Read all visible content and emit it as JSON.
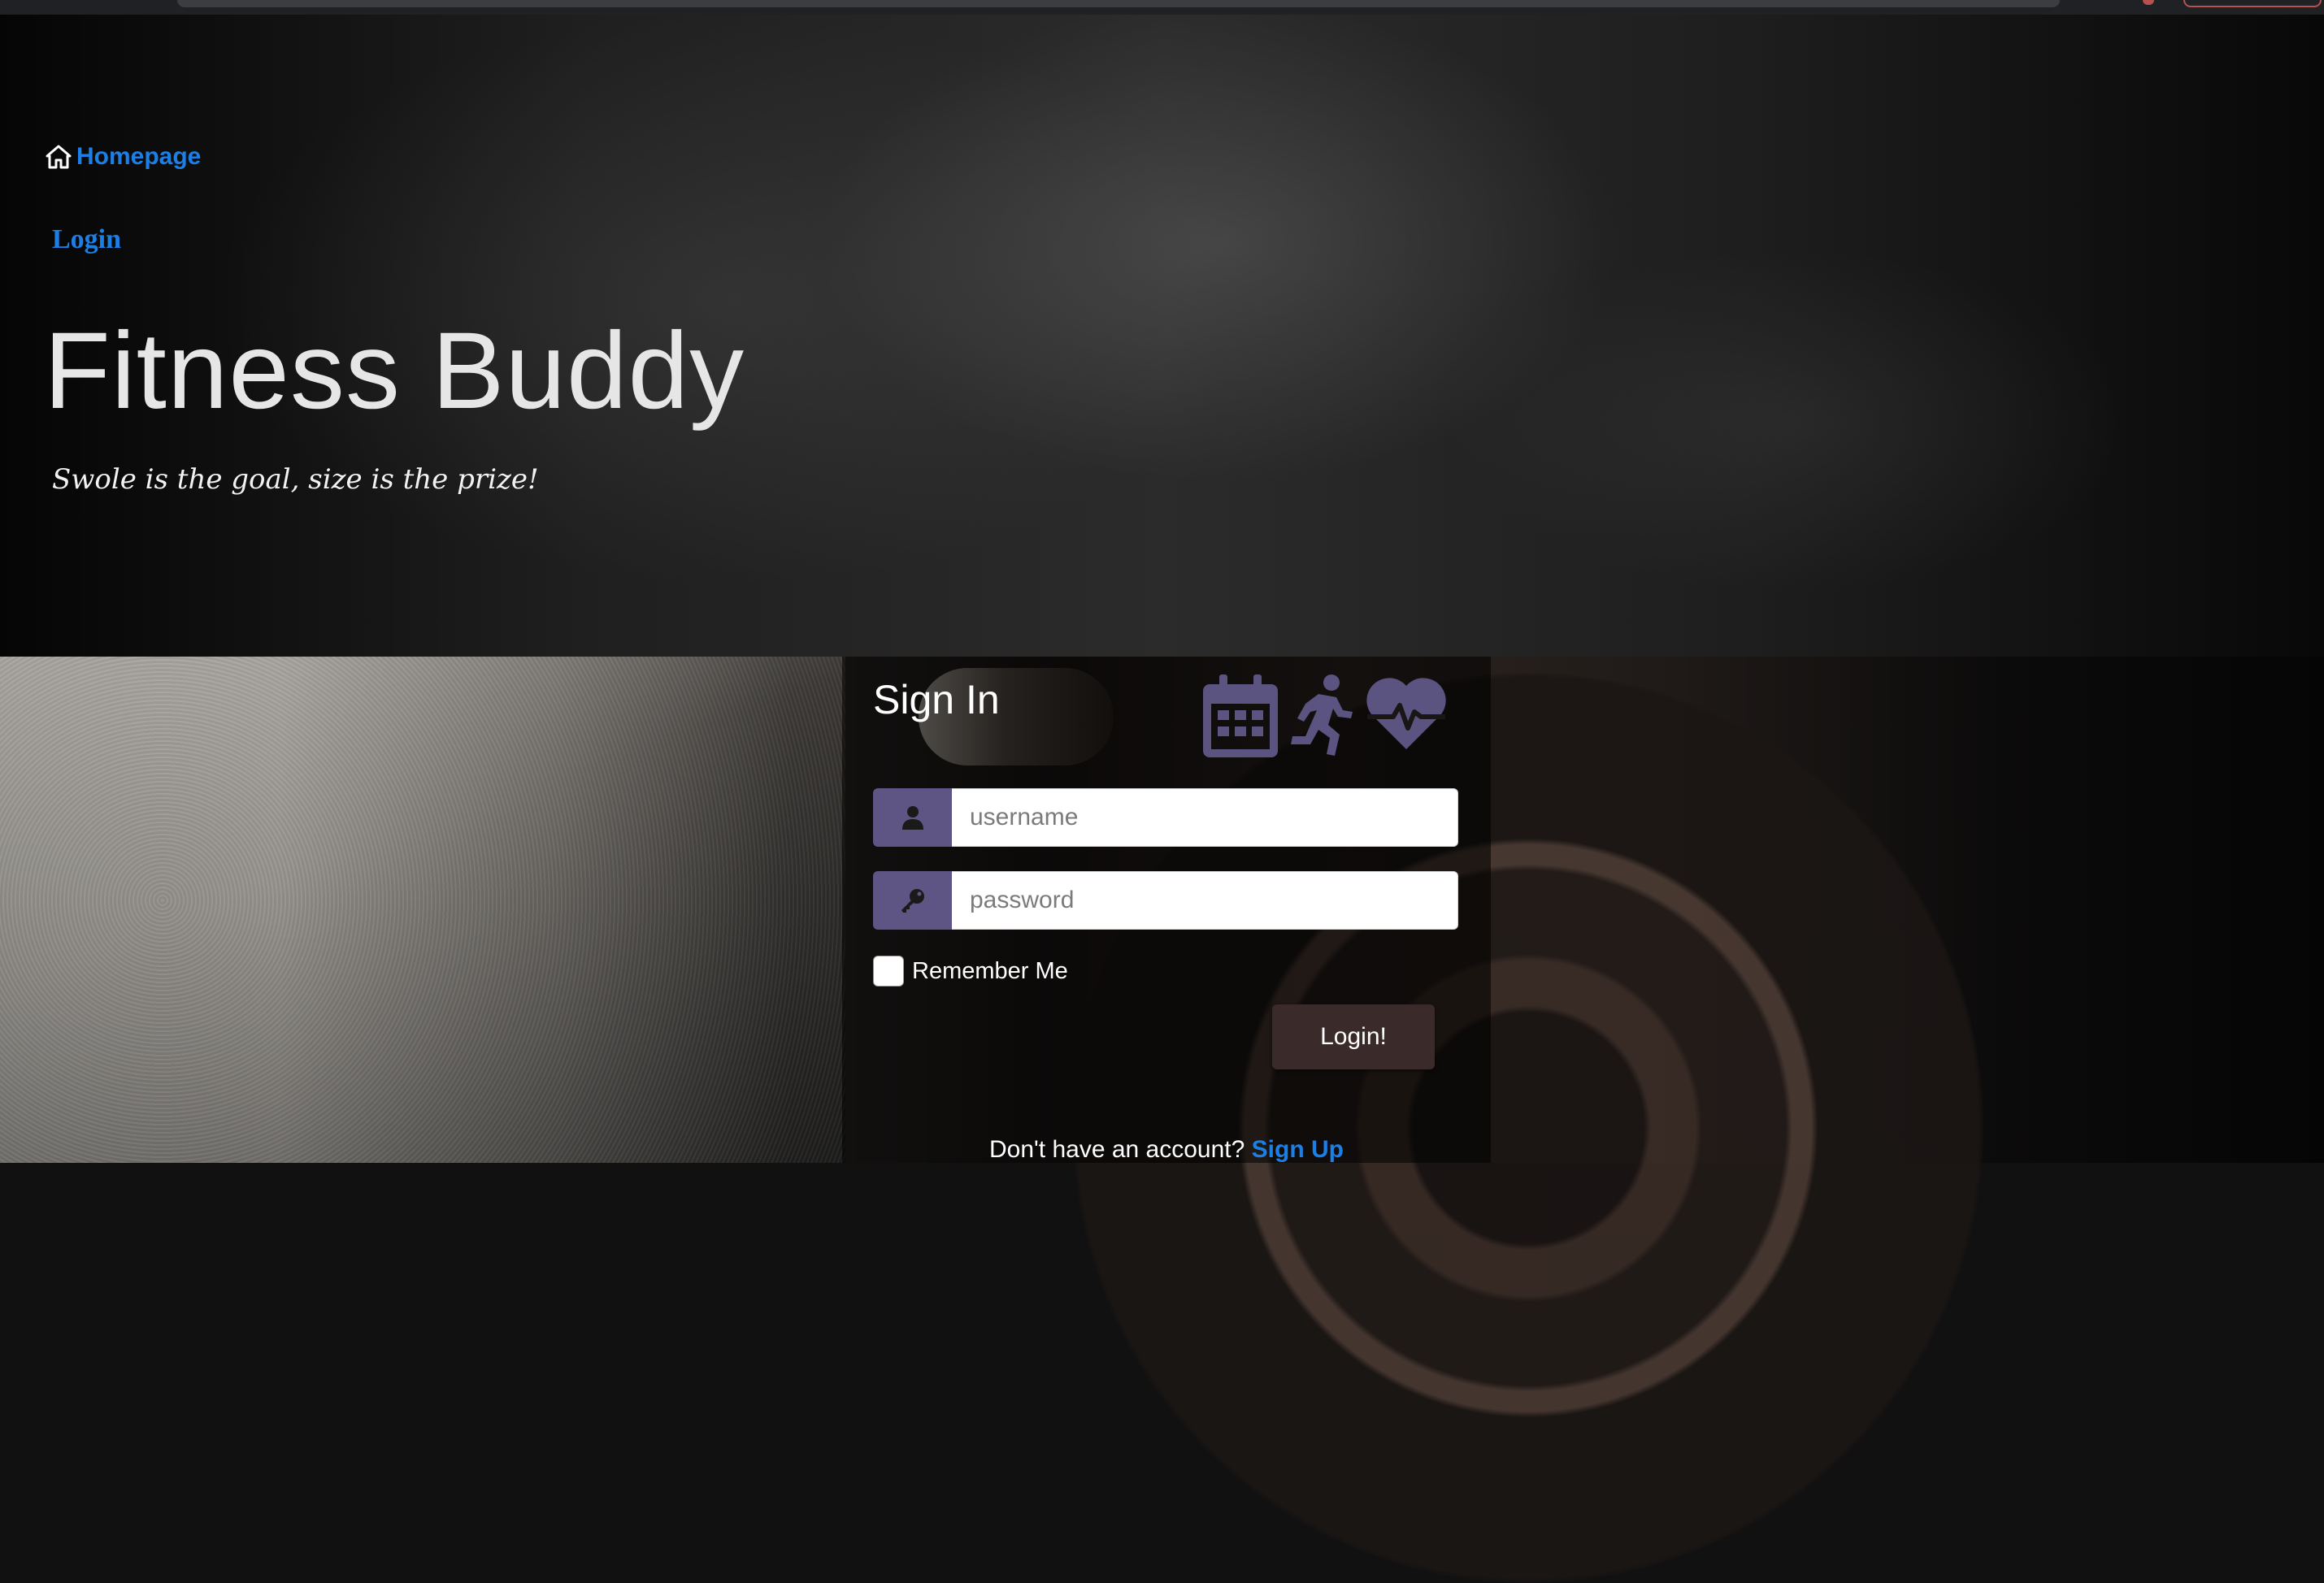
{
  "nav": {
    "home_label": "Homepage",
    "login_label": "Login"
  },
  "hero": {
    "title": "Fitness Buddy",
    "tagline": "Swole is the goal, size is the prize!"
  },
  "signin": {
    "title": "Sign In",
    "username_placeholder": "username",
    "password_placeholder": "password",
    "remember_label": "Remember Me",
    "remember_checked": false,
    "login_button": "Login!",
    "signup_prompt": "Don't have an account?",
    "signup_link": "Sign Up",
    "header_icons": [
      "calendar-icon",
      "running-person-icon",
      "heartbeat-icon"
    ]
  },
  "colors": {
    "link": "#1b7fe6",
    "accent_purple": "#5e5584",
    "icon_purple": "#5b5480",
    "button_bg": "#3b2a2a"
  }
}
